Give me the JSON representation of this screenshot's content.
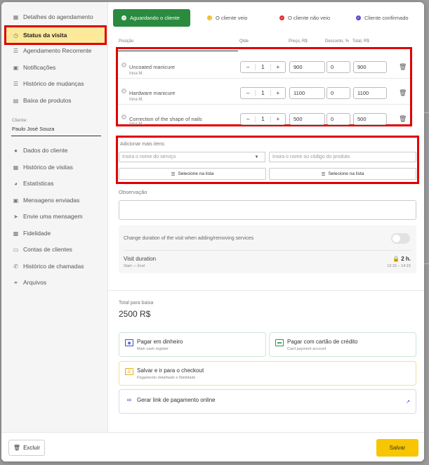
{
  "sidebar": {
    "items": [
      {
        "label": "Detalhes do agendamento",
        "icon": "calendar-icon"
      },
      {
        "label": "Status da visita",
        "icon": "clock-icon"
      },
      {
        "label": "Agendamento Recorrente",
        "icon": "list-icon"
      },
      {
        "label": "Notificações",
        "icon": "chat-icon"
      },
      {
        "label": "Histórico de mudanças",
        "icon": "list-icon"
      },
      {
        "label": "Baixa de produtos",
        "icon": "cart-icon"
      },
      {
        "label": "Dados do cliente",
        "icon": "user-icon"
      },
      {
        "label": "Histórico de visitas",
        "icon": "calendar-icon"
      },
      {
        "label": "Estatísticas",
        "icon": "pie-icon"
      },
      {
        "label": "Mensagens enviadas",
        "icon": "chat-icon"
      },
      {
        "label": "Envie uma mensagem",
        "icon": "send-icon"
      },
      {
        "label": "Fidelidade",
        "icon": "card-icon"
      },
      {
        "label": "Contas de clientes",
        "icon": "wallet-icon"
      },
      {
        "label": "Histórico de chamadas",
        "icon": "phone-icon"
      },
      {
        "label": "Arquivos",
        "icon": "paperclip-icon"
      }
    ],
    "client_label": "Cliente:",
    "client_name": "Paulo  José Souza"
  },
  "status_tabs": [
    {
      "label": "Aguardando o cliente",
      "color": "#2a8a3e",
      "active": true
    },
    {
      "label": "O cliente veio",
      "color": "#f0c030"
    },
    {
      "label": "O cliente não veio",
      "color": "#e03030"
    },
    {
      "label": "Cliente confirmado",
      "color": "#5a4ad0"
    }
  ],
  "columns": {
    "position": "Posição",
    "qty": "Qtde",
    "price": "Preço, R$",
    "discount": "Desconto, %",
    "total": "Total, R$"
  },
  "services": [
    {
      "name": "Uncoated manicure",
      "staff": "Inna M.",
      "qty": "1",
      "price": "900",
      "discount": "0",
      "total": "900"
    },
    {
      "name": "Hardware manicure",
      "staff": "Inna M.",
      "qty": "1",
      "price": "1100",
      "discount": "0",
      "total": "1100"
    },
    {
      "name": "Correction of the shape of nails",
      "staff": "Inna M.",
      "qty": "1",
      "price": "500",
      "discount": "0",
      "total": "500"
    }
  ],
  "add_items": {
    "label": "Adicionar mais itens:",
    "service_placeholder": "Insira o nome do serviço",
    "product_placeholder": "Insira o nome ou código do produto",
    "select_service_btn": "Selecione na lista",
    "select_product_btn": "Selecione na lista"
  },
  "observation": {
    "label": "Observação"
  },
  "duration": {
    "toggle_label": "Change duration of the visit when adding/removing services",
    "title": "Visit duration",
    "subtitle": "Start — End",
    "value": "2 h.",
    "range": "12:15 – 14:15"
  },
  "totals": {
    "label": "Total para baixa",
    "value": "2500 R$"
  },
  "payments": [
    {
      "title": "Pagar em dinheiro",
      "subtitle": "Main cash register",
      "icon": "cash-icon"
    },
    {
      "title": "Pagar com cartão de crédito",
      "subtitle": "Card payment account",
      "icon": "credit-card-icon"
    },
    {
      "title": "Salvar e ir para o checkout",
      "subtitle": "Pagamento detalhado e fidelidade",
      "icon": "checkout-icon"
    },
    {
      "title": "Gerar link de pagamento online",
      "subtitle": "",
      "icon": "link-icon"
    }
  ],
  "footer": {
    "delete_label": "Excluir",
    "save_label": "Salvar"
  },
  "colors": {
    "accent_green": "#2a8a3e",
    "save_yellow": "#f7c600",
    "active_item_bg": "#fde99a",
    "highlight_red": "#e00000"
  }
}
